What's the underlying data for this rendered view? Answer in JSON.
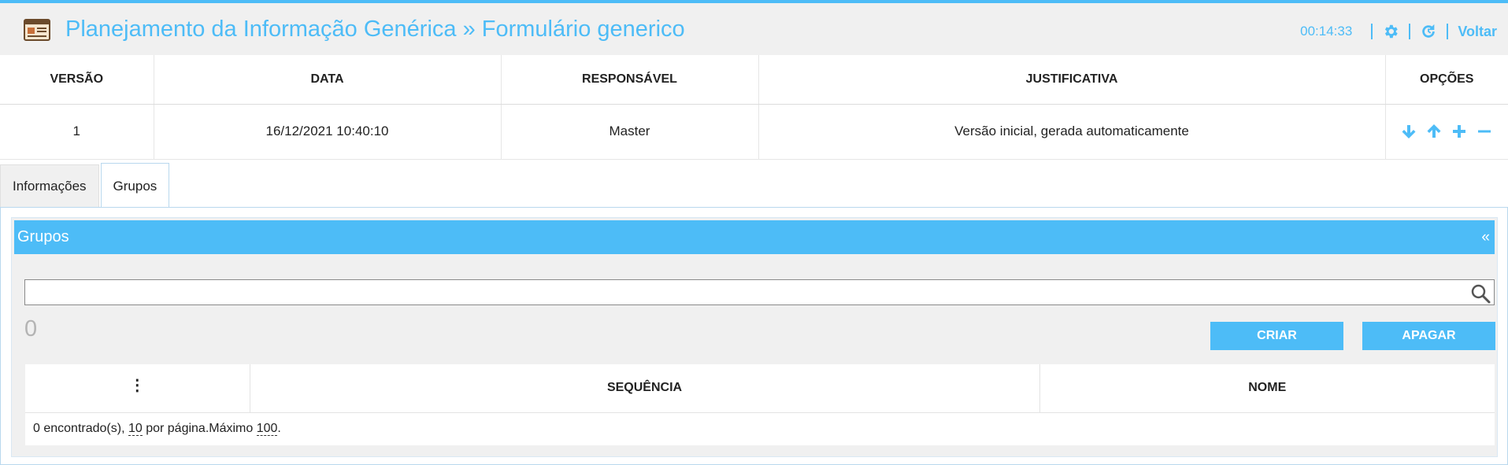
{
  "header": {
    "title": "Planejamento da Informação Genérica » Formulário generico",
    "clock": "00:14:33",
    "back_label": "Voltar",
    "icons": [
      "app-form-icon",
      "gear-icon",
      "refresh-icon"
    ]
  },
  "versions": {
    "columns": [
      "VERSÃO",
      "DATA",
      "RESPONSÁVEL",
      "JUSTIFICATIVA",
      "OPÇÕES"
    ],
    "rows": [
      {
        "version": "1",
        "date": "16/12/2021 10:40:10",
        "responsible": "Master",
        "justification": "Versão inicial, gerada automaticamente"
      }
    ],
    "option_icons": [
      "arrow-down-icon",
      "arrow-up-icon",
      "plus-icon",
      "minus-icon"
    ]
  },
  "tabs": [
    {
      "label": "Informações",
      "active": false
    },
    {
      "label": "Grupos",
      "active": true
    }
  ],
  "groups_panel": {
    "title": "Grupos",
    "collapse_label": "«",
    "search": {
      "value": "",
      "placeholder": ""
    },
    "count": "0",
    "create_label": "CRIAR",
    "delete_label": "APAGAR",
    "table": {
      "kebab": "⋮",
      "columns": [
        "SEQUÊNCIA",
        "NOME"
      ],
      "footer": {
        "found_text": "0 encontrado(s), ",
        "per_page_value": "10",
        "per_page_text": " por página.Máximo ",
        "max_value": "100",
        "end": "."
      }
    }
  },
  "colors": {
    "accent": "#4dbcf7",
    "background": "#f0f0f0"
  }
}
